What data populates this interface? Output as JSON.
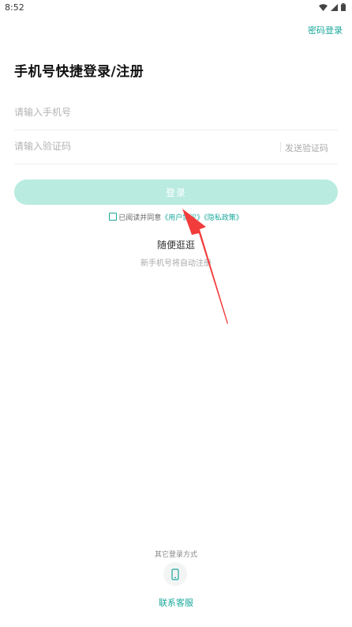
{
  "status_bar": {
    "time": "8:52",
    "icons": [
      "wifi-icon",
      "signal-icon",
      "battery-icon"
    ]
  },
  "header": {
    "password_login": "密码登录"
  },
  "title": "手机号快捷登录/注册",
  "phone_field": {
    "placeholder": "请输入手机号",
    "value": ""
  },
  "code_field": {
    "placeholder": "请输入验证码",
    "value": "",
    "send_code": "发送验证码"
  },
  "login_button": "登录",
  "agreement": {
    "checked": false,
    "prefix": "已阅读并同意",
    "user_agreement": "《用户协议》",
    "privacy_policy": "《隐私政策》"
  },
  "guest": {
    "label": "随便逛逛",
    "hint": "新手机号将自动注册"
  },
  "other_login": {
    "label": "其它登录方式",
    "icon": "phone-icon"
  },
  "support": "联系客服",
  "colors": {
    "accent": "#1aa89b",
    "button_disabled": "#b9ebe0",
    "arrow": "#f23c3c"
  }
}
